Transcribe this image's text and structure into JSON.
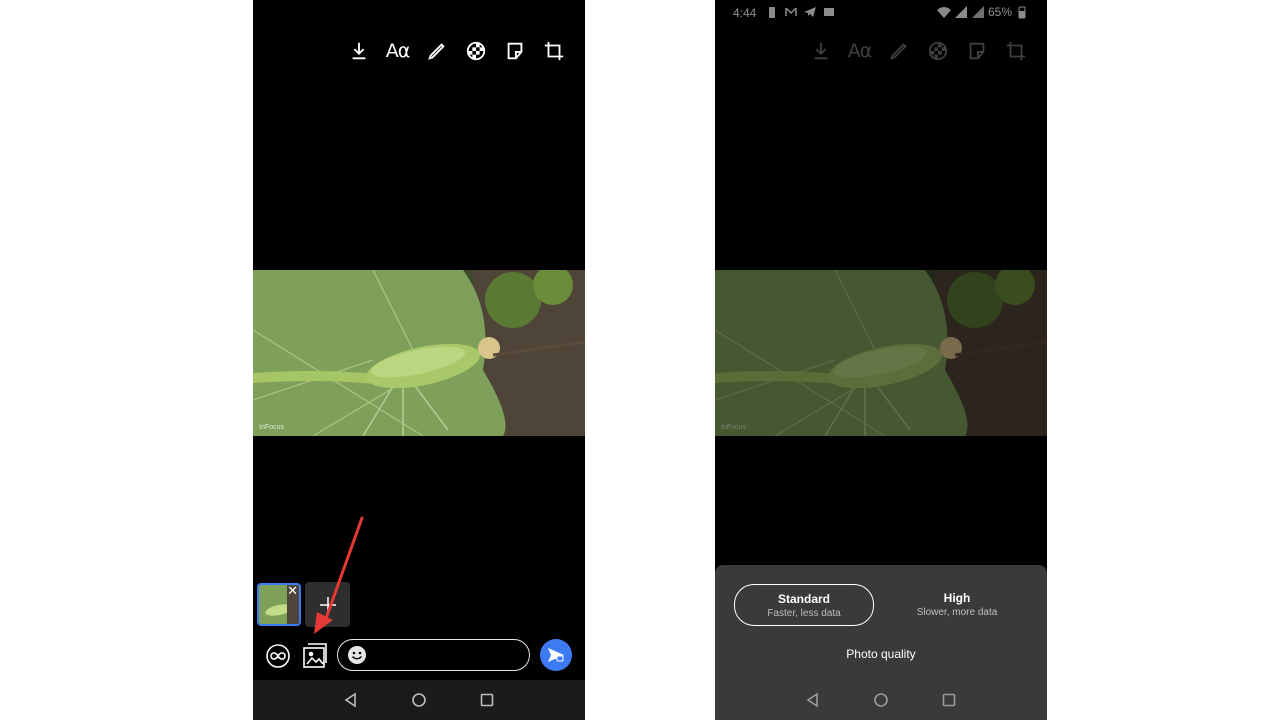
{
  "left_screen": {
    "toolbar": {
      "text_tool_label": "Aα"
    },
    "photo": {
      "watermark": "InFocus"
    },
    "thumbnail": {
      "close_glyph": "✕"
    },
    "composer": {
      "message_placeholder": ""
    },
    "annotation_arrow_color": "#e53935"
  },
  "right_screen": {
    "status_bar": {
      "time": "4:44",
      "battery": "65%"
    },
    "toolbar": {
      "text_tool_label": "Aα"
    },
    "photo": {
      "watermark": "InFocus"
    },
    "photo_quality_sheet": {
      "options": [
        {
          "title": "Standard",
          "subtitle": "Faster, less data",
          "selected": true
        },
        {
          "title": "High",
          "subtitle": "Slower, more data",
          "selected": false
        }
      ],
      "title": "Photo quality"
    }
  },
  "colors": {
    "accent": "#3d7bf5",
    "sheet_background": "#3a3a3a",
    "background": "#000000"
  },
  "icons": [
    "download-icon",
    "text-icon",
    "pen-icon",
    "blur-icon",
    "sticker-icon",
    "crop-icon",
    "plus-icon",
    "view-once-icon",
    "image-quality-icon",
    "emoji-icon",
    "send-icon",
    "nav-back-icon",
    "nav-home-icon",
    "nav-recents-icon"
  ]
}
